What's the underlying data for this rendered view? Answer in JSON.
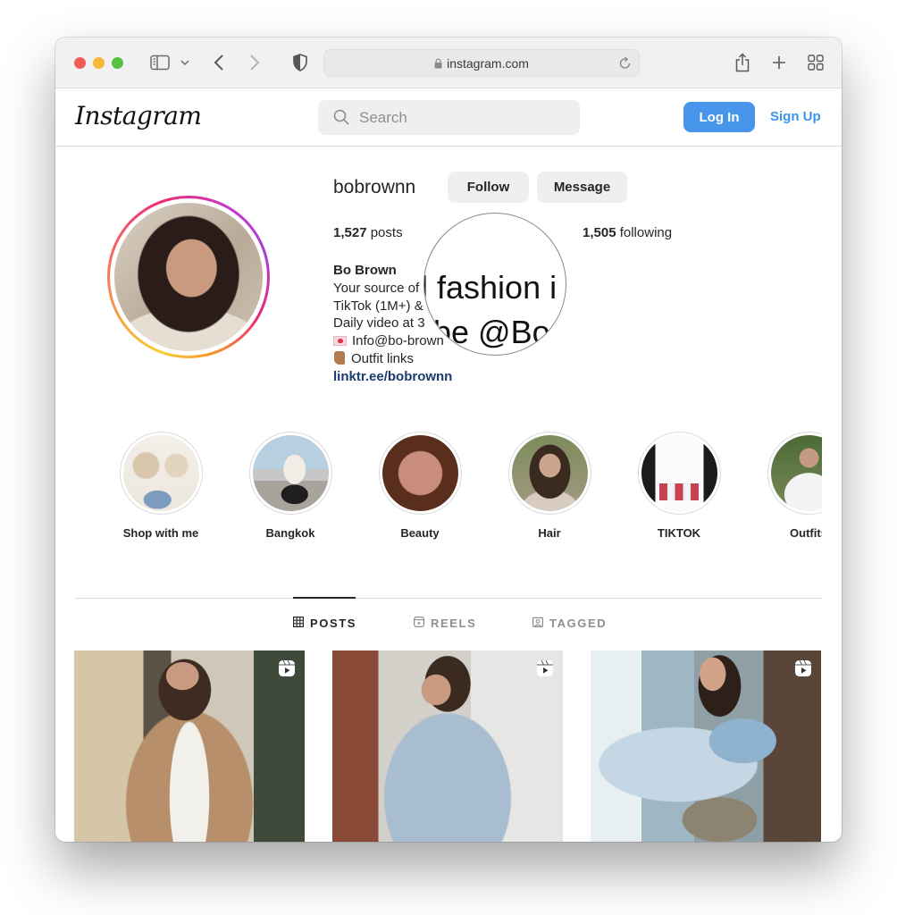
{
  "browser": {
    "url": "instagram.com",
    "icons": {
      "sidebar": "sidebar-icon",
      "back": "chevron-left-icon",
      "forward": "chevron-right-icon",
      "privacy": "shield-icon",
      "lock": "lock-icon",
      "reload": "reload-icon",
      "share": "share-icon",
      "new_tab": "plus-icon",
      "tab_overview": "tabs-grid-icon"
    }
  },
  "header": {
    "logo": "Instagram",
    "search_placeholder": "Search",
    "login_label": "Log In",
    "signup_label": "Sign Up",
    "accent_color": "#4896ec"
  },
  "profile": {
    "username": "bobrownn",
    "follow_label": "Follow",
    "message_label": "Message",
    "posts_count": "1,527",
    "posts_label": "posts",
    "following_count": "1,505",
    "following_label": "following",
    "bio": {
      "name": "Bo Brown",
      "lines": [
        "Your source of",
        "TikTok (1M+) &",
        "Daily video at 3",
        "Info@bo-brown",
        "Outfit links"
      ],
      "link": "linktr.ee/bobrownn"
    },
    "magnifier": {
      "line1": "l fashion i",
      "line2": "be @Bo"
    }
  },
  "highlights": [
    {
      "label": "Shop with me"
    },
    {
      "label": "Bangkok"
    },
    {
      "label": "Beauty"
    },
    {
      "label": "Hair"
    },
    {
      "label": "TIKTOK"
    },
    {
      "label": "Outfits"
    }
  ],
  "tabs": [
    {
      "label": "POSTS",
      "icon": "grid-icon",
      "active": true
    },
    {
      "label": "REELS",
      "icon": "reels-icon",
      "active": false
    },
    {
      "label": "TAGGED",
      "icon": "tagged-icon",
      "active": false
    }
  ],
  "posts": [
    {
      "type": "reel",
      "description": "woman in quilted tan jacket holding coffee cup"
    },
    {
      "type": "reel",
      "description": "woman in light blue hoodie on street"
    },
    {
      "type": "reel",
      "description": "woman in denim outfit sitting by window with bag"
    }
  ]
}
